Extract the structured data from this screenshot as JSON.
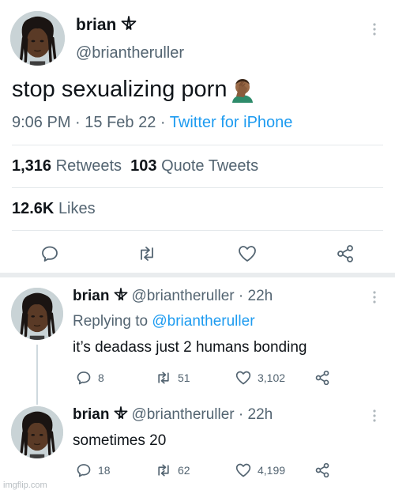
{
  "main_tweet": {
    "display_name": "brian",
    "handle": "@briantheruller",
    "text": "stop sexualizing porn",
    "emoji_icon": "facepalm-icon",
    "time": "9:06 PM",
    "date": "15 Feb 22",
    "separator": "·",
    "source": "Twitter for iPhone",
    "retweets_count": "1,316",
    "retweets_label": "Retweets",
    "quotes_count": "103",
    "quotes_label": "Quote Tweets",
    "likes_count": "12.6K",
    "likes_label": "Likes",
    "actions": [
      "reply-icon",
      "retweet-icon",
      "like-icon",
      "share-icon"
    ]
  },
  "replies": [
    {
      "display_name": "brian",
      "handle_time": "@briantheruller · 22h",
      "replying_prefix": "Replying to",
      "replying_to": "@briantheruller",
      "text": "it’s deadass just 2 humans bonding",
      "reply_count": "8",
      "retweet_count": "51",
      "like_count": "3,102"
    },
    {
      "display_name": "brian",
      "handle_time": "@briantheruller · 22h",
      "text": "sometimes 20",
      "reply_count": "18",
      "retweet_count": "62",
      "like_count": "4,199"
    }
  ],
  "watermark": "imgflip.com",
  "colors": {
    "text": "#0f1419",
    "muted": "#536471",
    "link": "#1d9bf0",
    "divider": "#e4e8eb"
  }
}
